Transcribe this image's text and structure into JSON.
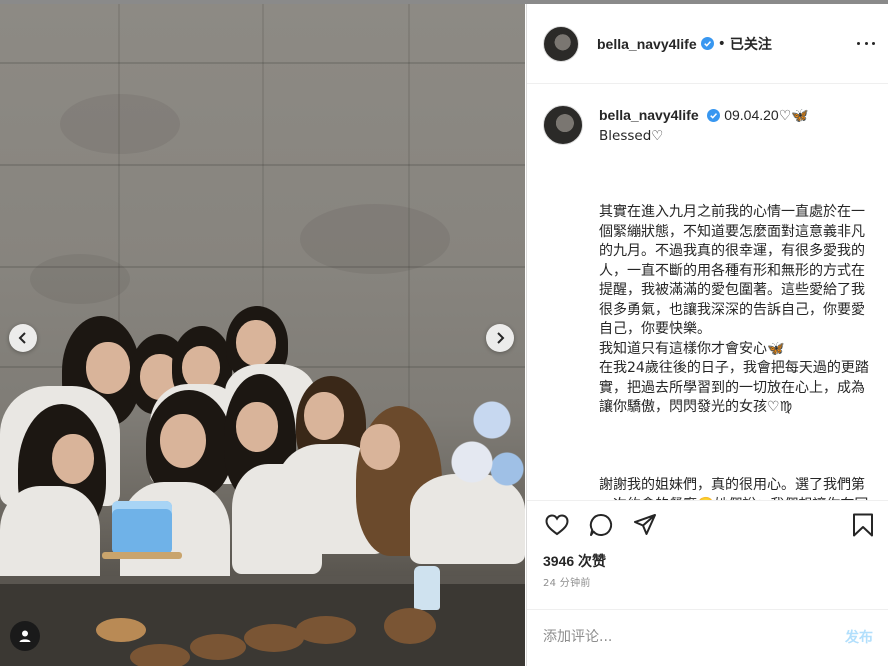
{
  "post": {
    "username": "bella_navy4life",
    "follow_status": "已关注",
    "separator": "•",
    "caption": {
      "date_tag": "09.04.20♡🦋",
      "line1": "Blessed♡",
      "paragraphs": [
        "其實在進入九月之前我的心情一直處於在一個緊繃狀態，不知道要怎麼面對這意義非凡的九月。不過我真的很幸運，有很多愛我的人，一直不斷的用各種有形和無形的方式在提醒，我被滿滿的愛包圍著。這些愛給了我很多勇氣，也讓我深深的告訴自己，你要愛自己，你要快樂。\n我知道只有這樣你才會安心🦋\n在我24歲往後的日子，我會把每天過的更踏實，把過去所學習到的一切放在心上，成為讓你驕傲，閃閃發光的女孩♡♍",
        "謝謝我的姐妹們，真的很用心。選了我們第一次約會的餐廳🥲她們說：我們想讓你在同一個地方，創造不同的美好回憶"
      ]
    },
    "likes": "3946 次赞",
    "time_ago": "24 分钟前",
    "comment_placeholder": "添加评论...",
    "post_label": "发布"
  },
  "icons": {
    "more": "more-options-icon",
    "like": "heart-icon",
    "comment": "comment-icon",
    "share": "share-icon",
    "save": "bookmark-icon",
    "prev": "chevron-left-icon",
    "next": "chevron-right-icon",
    "tags": "user-tag-icon",
    "verified": "verified-badge-icon"
  },
  "colors": {
    "verified": "#3897f0",
    "post_button_disabled": "#b2dffc",
    "muted_text": "#8e8e8e"
  }
}
